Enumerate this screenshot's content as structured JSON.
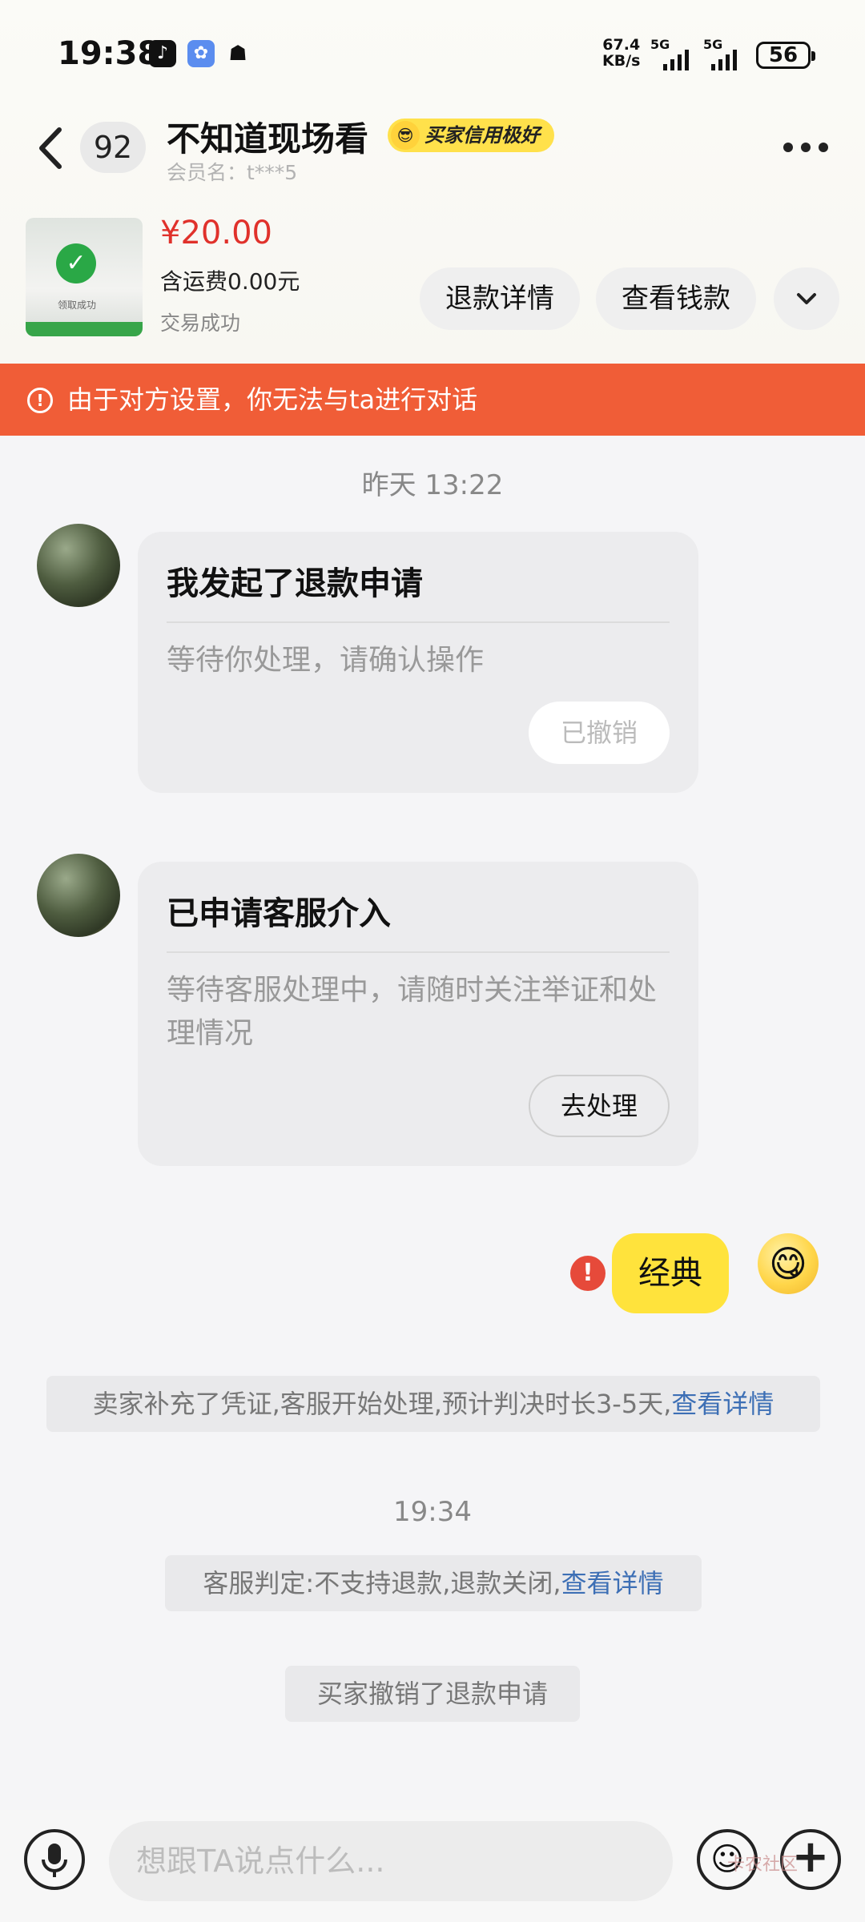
{
  "status_bar": {
    "time": "19:38",
    "net_speed_value": "67.4",
    "net_speed_unit": "KB/s",
    "sim1": "5G",
    "sim2": "5G",
    "battery": "56"
  },
  "header": {
    "unread_count": "92",
    "title": "不知道现场看",
    "credit_badge": "买家信用极好",
    "member_name": "会员名：t***5"
  },
  "order": {
    "price": "¥20.00",
    "shipping": "含运费0.00元",
    "status": "交易成功",
    "thumb_text": "领取成功",
    "refund_detail_label": "退款详情",
    "view_payment_label": "查看钱款"
  },
  "banner": {
    "text": "由于对方设置，你无法与ta进行对话"
  },
  "messages": {
    "time1": "昨天 13:22",
    "card1": {
      "title": "我发起了退款申请",
      "subtitle": "等待你处理，请确认操作",
      "button": "已撤销"
    },
    "card2": {
      "title": "已申请客服介入",
      "subtitle": "等待客服处理中，请随时关注举证和处理情况",
      "button": "去处理"
    },
    "my_message": "经典",
    "sys1_text": "卖家补充了凭证,客服开始处理,预计判决时长3-5天,",
    "sys1_link": "查看详情",
    "time2": "19:34",
    "sys2_text": "客服判定:不支持退款,退款关闭,",
    "sys2_link": "查看详情",
    "sys3_text": "买家撤销了退款申请"
  },
  "input": {
    "placeholder": "想跟TA说点什么..."
  },
  "watermark": "卡农社区",
  "colors": {
    "banner": "#f05d37",
    "price": "#e0312b",
    "link": "#3d6fb5",
    "badge": "#ffe14b",
    "my_bubble": "#ffe33c"
  }
}
